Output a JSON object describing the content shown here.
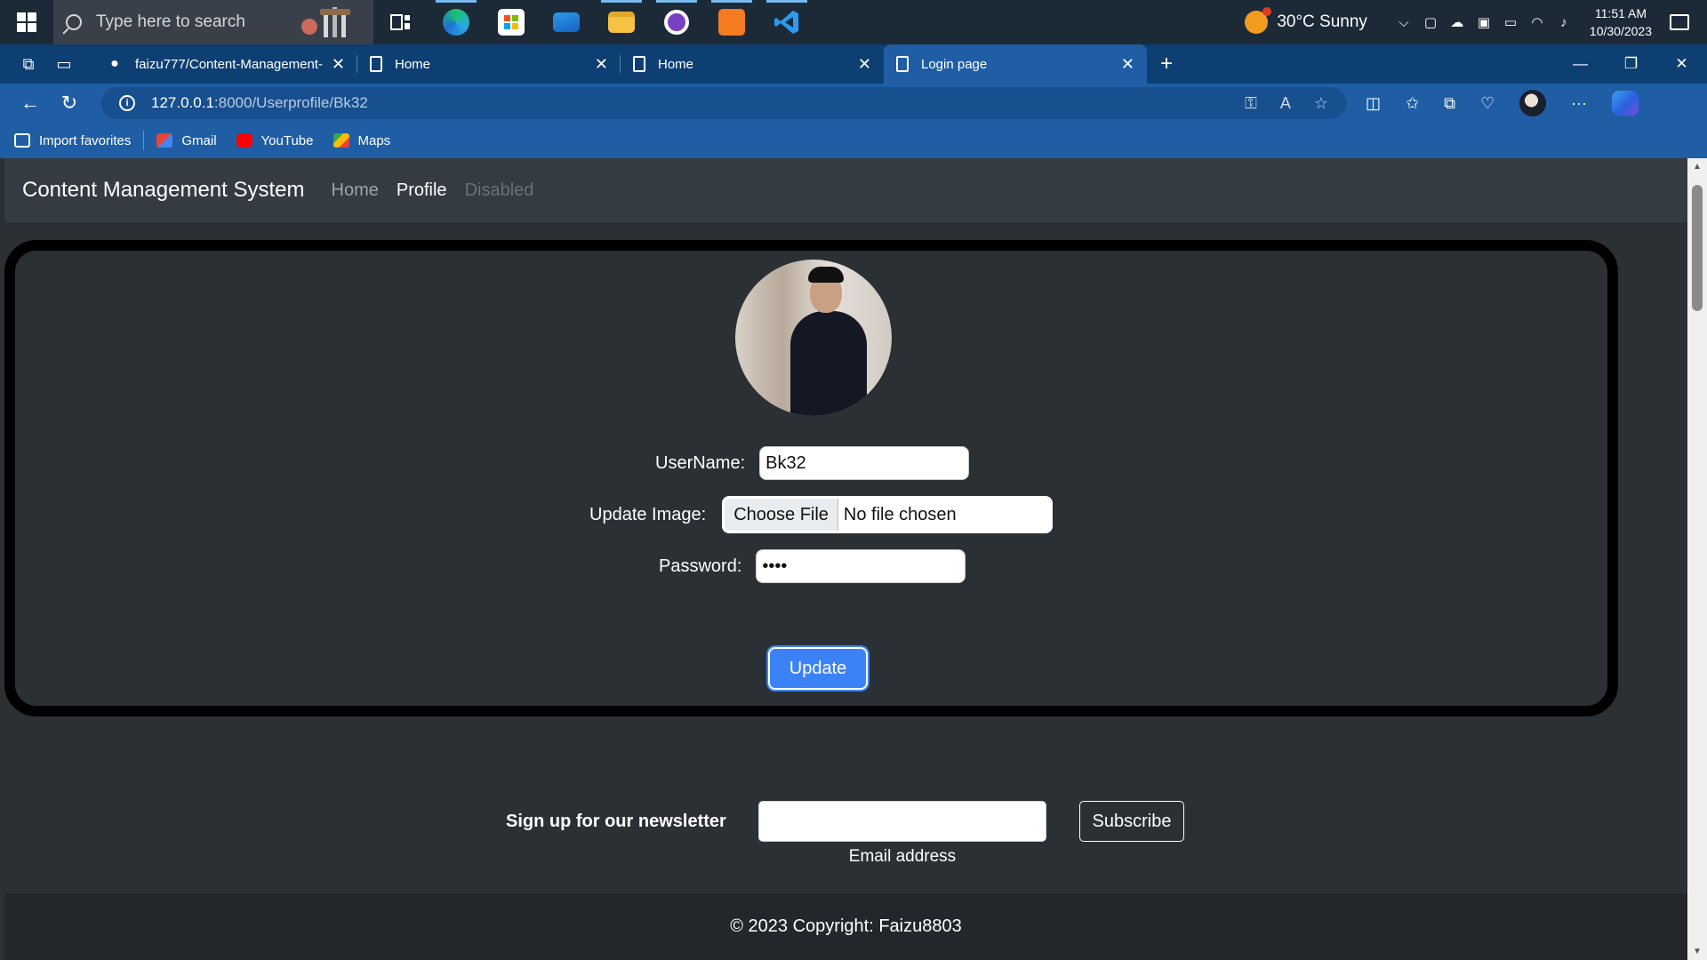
{
  "taskbar": {
    "search_placeholder": "Type here to search",
    "weather": "30°C  Sunny",
    "time": "11:51 AM",
    "date": "10/30/2023"
  },
  "browser": {
    "tabs": [
      {
        "title": "faizu777/Content-Management-",
        "icon": "github-icon"
      },
      {
        "title": "Home",
        "icon": "page-icon"
      },
      {
        "title": "Home",
        "icon": "page-icon"
      },
      {
        "title": "Login page",
        "icon": "page-icon",
        "active": true
      }
    ],
    "address_host": "127.0.0.1",
    "address_path": ":8000/Userprofile/Bk32",
    "favorites": [
      {
        "label": "Import favorites"
      },
      {
        "label": "Gmail"
      },
      {
        "label": "YouTube"
      },
      {
        "label": "Maps"
      }
    ]
  },
  "navbar": {
    "brand": "Content Management System",
    "links": [
      "Home",
      "Profile",
      "Disabled"
    ]
  },
  "profile_form": {
    "username_label": "UserName:",
    "username_value": "Bk32",
    "image_label": "Update Image:",
    "choose_file": "Choose File",
    "no_file": "No file chosen",
    "password_label": "Password:",
    "password_value": "••••",
    "update_button": "Update"
  },
  "newsletter": {
    "label": "Sign up for our newsletter",
    "email_help": "Email address",
    "subscribe_button": "Subscribe"
  },
  "footer": {
    "copyright": "© 2023 Copyright: Faizu8803"
  },
  "colors": {
    "taskbar": "#1c2a38",
    "tabstrip": "#0e3f72",
    "toolbar": "#1f5ea4",
    "page_bg": "#2b3035",
    "navbar_bg": "#353b42",
    "primary_button": "#3b82f6",
    "footer_bg": "#23272b"
  }
}
